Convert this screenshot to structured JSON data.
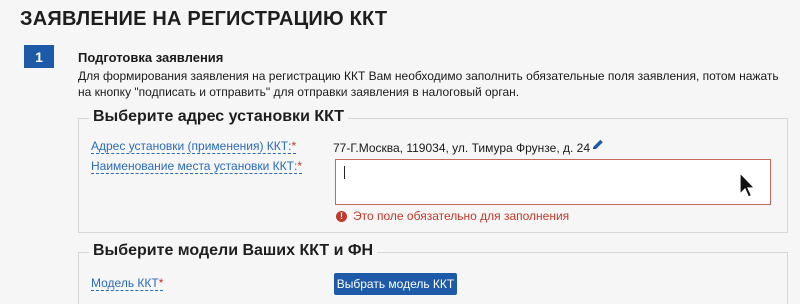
{
  "page": {
    "title": "ЗАЯВЛЕНИЕ НА РЕГИСТРАЦИЮ ККТ"
  },
  "step": {
    "number": "1",
    "title": "Подготовка заявления",
    "description": "Для формирования заявления на регистрацию ККТ Вам необходимо заполнить обязательные поля заявления, потом нажать на кнопку \"подписать и отправить\" для отправки заявления в налоговый орган."
  },
  "address_section": {
    "legend": "Выберите адрес установки ККТ",
    "address_label": "Адрес установки (применения) ККТ:",
    "address_value": "77-Г.Москва, 119034, ул. Тимура Фрунзе, д. 24",
    "place_label": "Наименование места установки ККТ:",
    "place_value": "",
    "error_text": "Это поле обязательно для заполнения",
    "required_mark": "*"
  },
  "model_section": {
    "legend": "Выберите модели Ваших ККТ и ФН",
    "model_label": "Модель ККТ",
    "choose_button": "Выбрать модель ККТ",
    "required_mark": "*"
  },
  "colors": {
    "brand_blue": "#1d5ba8",
    "link_blue": "#2b6cb8",
    "error_red": "#c0392b"
  },
  "icons": {
    "edit": "pencil-icon",
    "error": "error-icon",
    "cursor": "mouse-cursor-icon"
  }
}
